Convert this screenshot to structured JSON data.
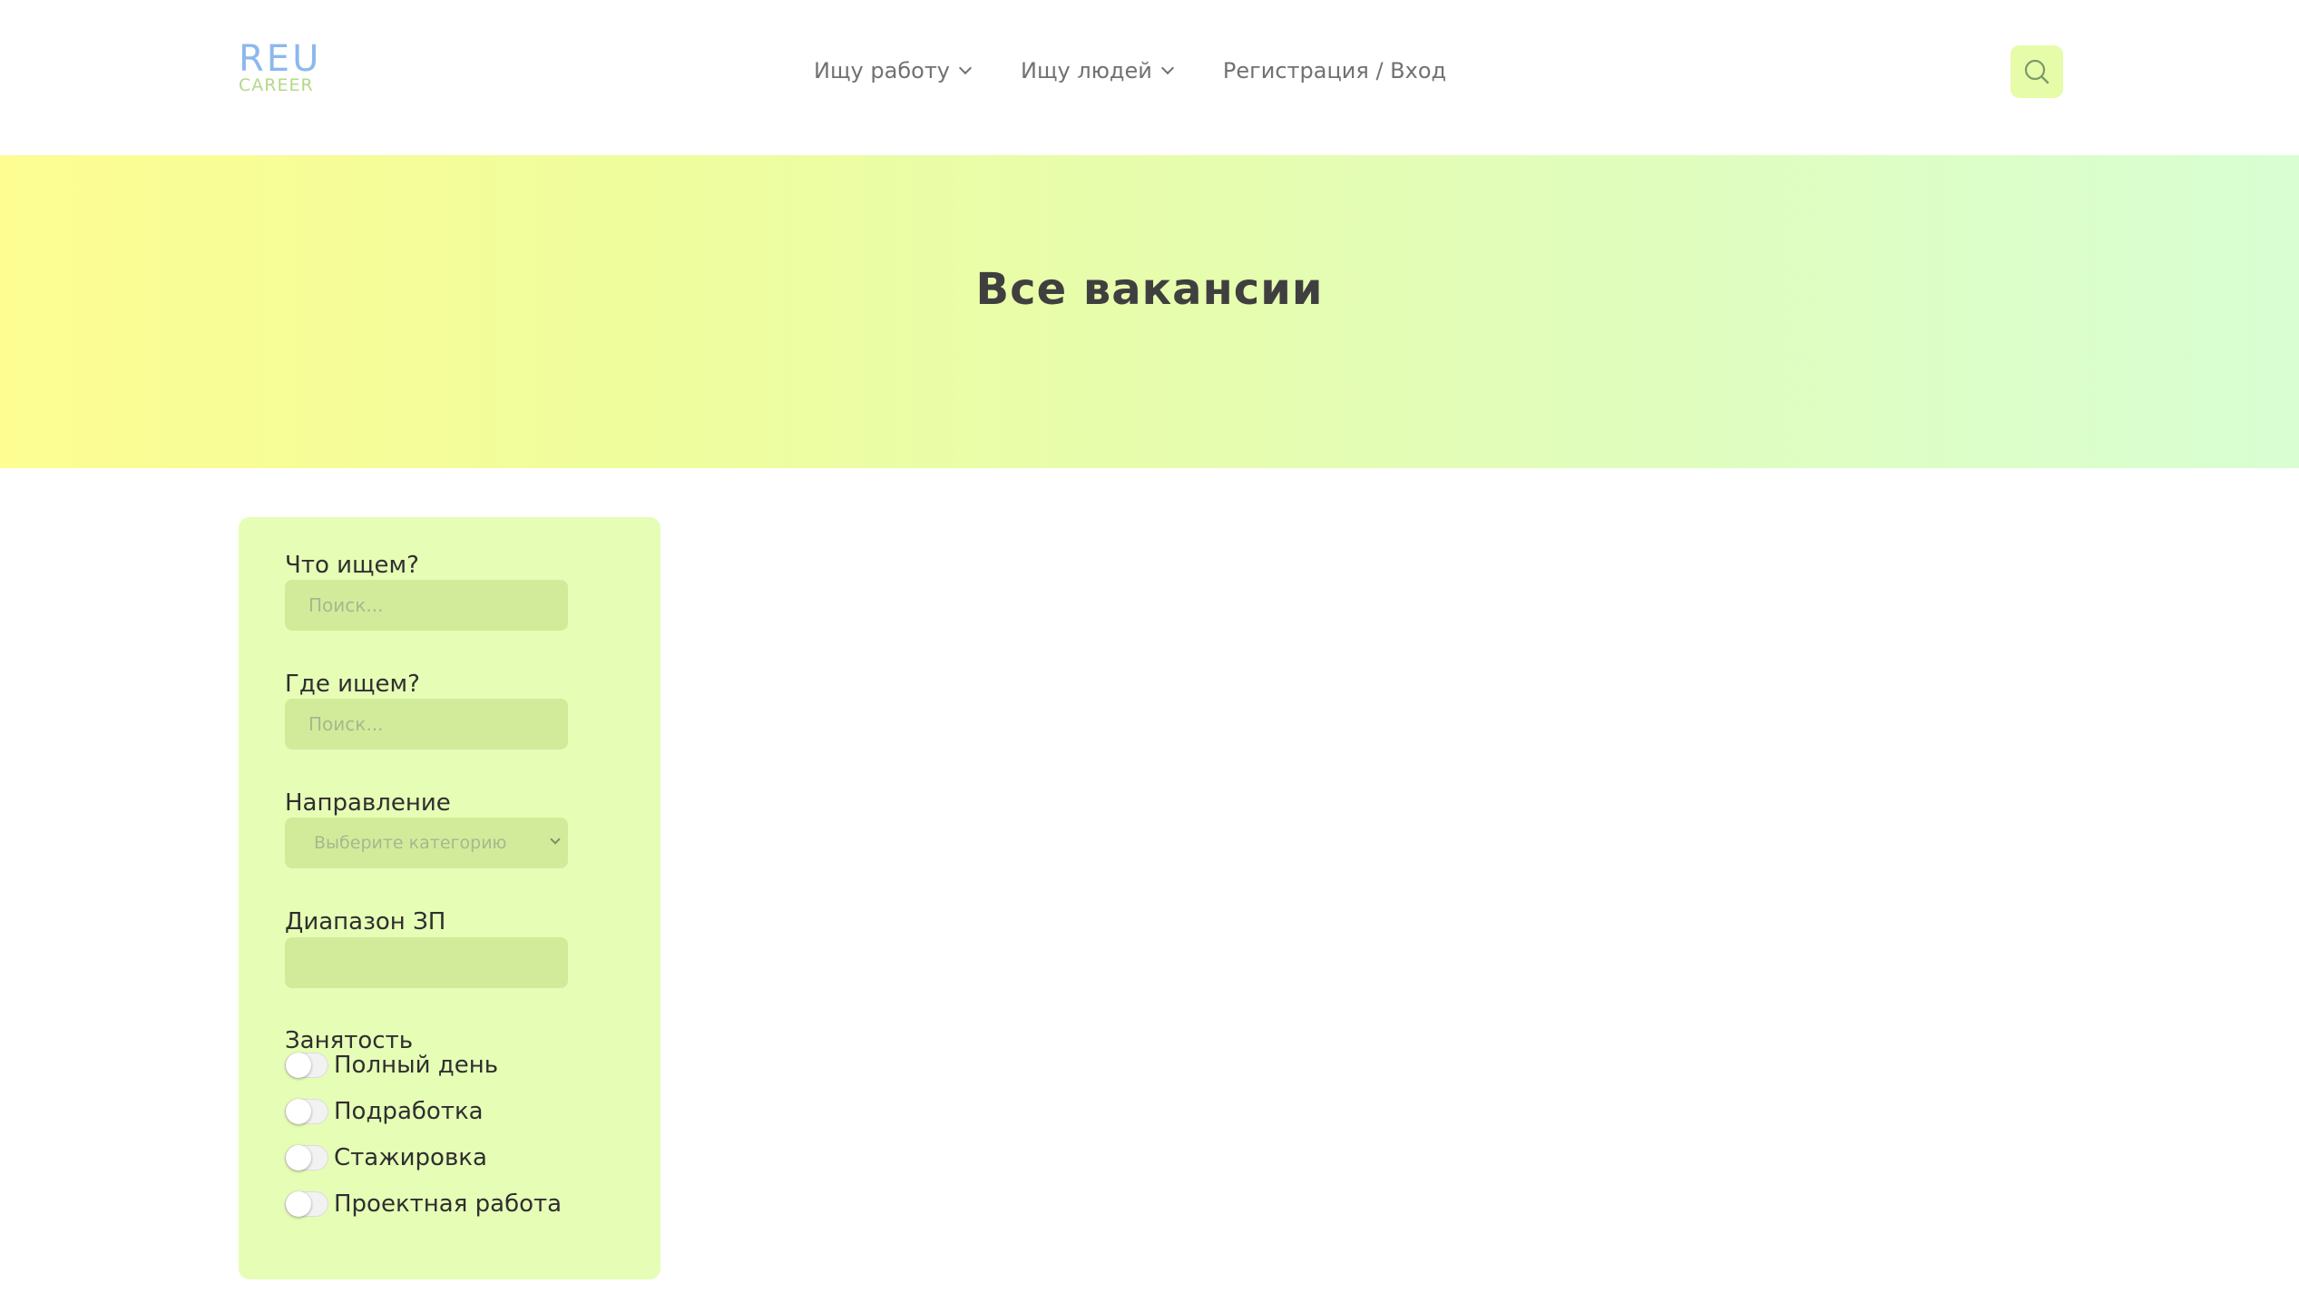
{
  "header": {
    "logo": {
      "top": "REU",
      "bottom": "CAREER"
    },
    "nav": [
      {
        "label": "Ищу работу",
        "has_dropdown": true
      },
      {
        "label": "Ищу людей",
        "has_dropdown": true
      },
      {
        "label": "Регистрация / Вход",
        "has_dropdown": false
      }
    ],
    "search_icon": "search-icon"
  },
  "hero": {
    "title": "Все вакансии"
  },
  "filters": {
    "what": {
      "label": "Что ищем?",
      "placeholder": "Поиск...",
      "value": ""
    },
    "where": {
      "label": "Где ищем?",
      "placeholder": "Поиск...",
      "value": ""
    },
    "direction": {
      "label": "Направление",
      "selected": "Выберите категорию"
    },
    "salary": {
      "label": "Диапазон ЗП",
      "value": ""
    },
    "employment": {
      "label": "Занятость",
      "options": [
        {
          "label": "Полный день",
          "checked": false
        },
        {
          "label": "Подработка",
          "checked": false
        },
        {
          "label": "Стажировка",
          "checked": false
        },
        {
          "label": "Проектная работа",
          "checked": false
        }
      ]
    }
  },
  "colors": {
    "accent_green": "#e6fca8",
    "panel_bg": "#e6fdb6",
    "input_bg": "#d2eb9a",
    "logo_blue": "#8cb8ec",
    "logo_green": "#b4d888"
  }
}
